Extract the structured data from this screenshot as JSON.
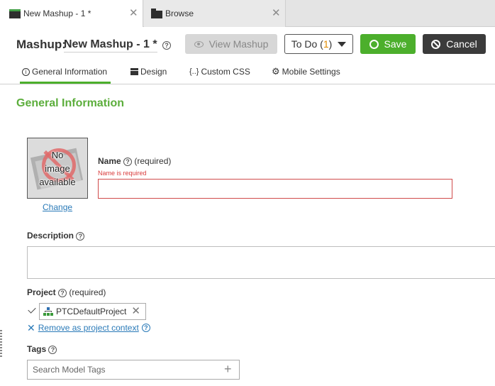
{
  "tabs": [
    {
      "label": "New Mashup - 1 *",
      "icon": "mashup-icon",
      "active": true
    },
    {
      "label": "Browse",
      "icon": "folder-icon",
      "active": false
    }
  ],
  "tab_close_glyph": "✕",
  "header": {
    "label": "Mashup:",
    "name": "New Mashup - 1 *",
    "view_mashup": "View Mashup",
    "todo_text": "To Do (",
    "todo_count": "1",
    "todo_close": ")",
    "save": "Save",
    "cancel": "Cancel"
  },
  "subtabs": [
    {
      "label": "General Information",
      "icon": "info-icon"
    },
    {
      "label": "Design",
      "icon": "design-icon"
    },
    {
      "label": "Custom CSS",
      "icon": "css-icon",
      "icon_text": "{..}"
    },
    {
      "label": "Mobile Settings",
      "icon": "gear-icon"
    }
  ],
  "section_title": "General Information",
  "image": {
    "placeholder_text": [
      "No",
      "image",
      "available"
    ],
    "change_link": "Change"
  },
  "fields": {
    "name": {
      "label": "Name",
      "required": "(required)",
      "error": "Name is required",
      "value": ""
    },
    "description": {
      "label": "Description",
      "value": ""
    },
    "project": {
      "label": "Project",
      "required": "(required)",
      "value": "PTCDefaultProject",
      "remove_context": "Remove as project context"
    },
    "tags": {
      "label": "Tags",
      "placeholder": "Search Model Tags"
    }
  },
  "help_glyph": "?",
  "colors": {
    "accent_green": "#4caf2c",
    "section_green": "#5cae3c",
    "error_red": "#d93b3b",
    "link_blue": "#2a7ab8",
    "cancel_dark": "#3b3b3b"
  }
}
